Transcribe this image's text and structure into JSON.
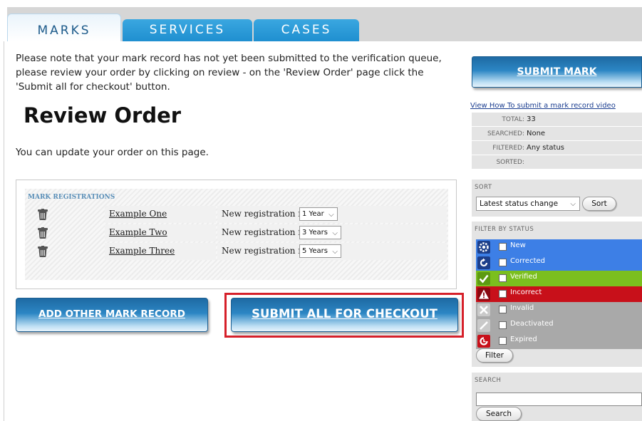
{
  "tabs": [
    {
      "label": "MARKS"
    },
    {
      "label": "SERVICES"
    },
    {
      "label": "CASES"
    }
  ],
  "notice": "Please note that your mark record has not yet been submitted to the verification queue, please review your order by clicking on review - on the 'Review Order' page click the 'Submit all for checkout' button.",
  "page_title": "Review Order",
  "update_text": "You can update your order on this page.",
  "registrations": {
    "header": "MARK REGISTRATIONS",
    "option_label": "New registration for",
    "rows": [
      {
        "name": "Example One",
        "term": "1 Year"
      },
      {
        "name": "Example Two",
        "term": "3 Years"
      },
      {
        "name": "Example Three",
        "term": "5 Years"
      }
    ]
  },
  "buttons": {
    "add_other": "ADD OTHER MARK RECORD",
    "submit_all": "SUBMIT ALL FOR CHECKOUT",
    "submit_mark": "SUBMIT MARK"
  },
  "sidebar": {
    "video_link": "View How To submit a mark record video",
    "stats": [
      {
        "label": "TOTAL:",
        "value": "33"
      },
      {
        "label": "SEARCHED:",
        "value": "None"
      },
      {
        "label": "FILTERED:",
        "value": "Any status"
      },
      {
        "label": "SORTED:",
        "value": ""
      }
    ],
    "sort": {
      "title": "SORT",
      "selected": "Latest status change",
      "button": "Sort"
    },
    "filter": {
      "title": "FILTER BY STATUS",
      "button": "Filter",
      "statuses": [
        {
          "label": "New",
          "color": "#3d7fe6",
          "icon": "gear-icon"
        },
        {
          "label": "Corrected",
          "color": "#3d7fe6",
          "icon": "refresh-icon"
        },
        {
          "label": "Verified",
          "color": "#7bbf1e",
          "icon": "check-icon"
        },
        {
          "label": "Incorrect",
          "color": "#c8101a",
          "icon": "warning-icon"
        },
        {
          "label": "Invalid",
          "color": "#a9a9a9",
          "icon": "x-icon"
        },
        {
          "label": "Deactivated",
          "color": "#a9a9a9",
          "icon": "slash-icon"
        },
        {
          "label": "Expired",
          "color": "#a9a9a9",
          "icon": "clock-icon"
        }
      ]
    },
    "search": {
      "title": "SEARCH",
      "button": "Search",
      "value": ""
    }
  },
  "colors": {
    "tab_blue": "#2a9ad8",
    "button_blue": "#2c86c4",
    "highlight_red": "#d6202a"
  }
}
